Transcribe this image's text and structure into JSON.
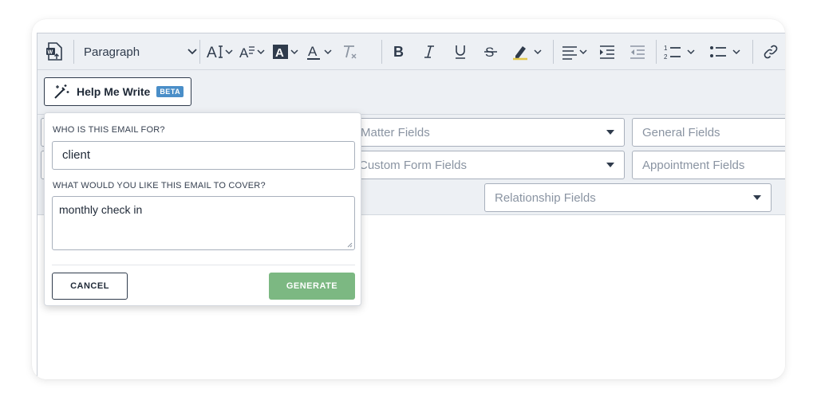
{
  "toolbar": {
    "paragraph_label": "Paragraph"
  },
  "help_me_write": {
    "label": "Help Me Write",
    "badge": "BETA"
  },
  "fields": {
    "matter_fields": "Matter Fields",
    "general_fields": "General Fields",
    "custom_form_fields": "Custom Form Fields",
    "appointment_fields": "Appointment Fields",
    "relationship_fields": "Relationship Fields"
  },
  "popup": {
    "who_label": "WHO IS THIS EMAIL FOR?",
    "who_value": "client",
    "cover_label": "WHAT WOULD YOU LIKE THIS EMAIL TO COVER?",
    "cover_value": "monthly check in",
    "cancel_label": "CANCEL",
    "generate_label": "GENERATE"
  },
  "colors": {
    "generate_button": "#7cb882",
    "beta_badge": "#4a8ec8",
    "toolbar_bg": "#edf0f4"
  }
}
